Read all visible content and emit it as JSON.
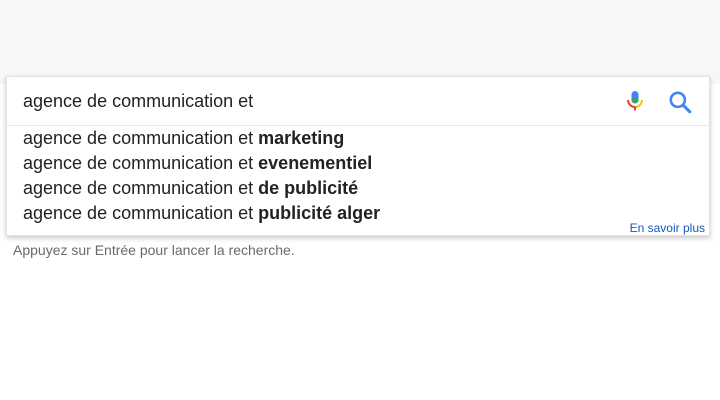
{
  "search": {
    "query": "agence de communication et",
    "suggestions": [
      {
        "prefix": "agence de communication et ",
        "completion": "marketing"
      },
      {
        "prefix": "agence de communication et ",
        "completion": "evenementiel"
      },
      {
        "prefix": "agence de communication et ",
        "completion": "de publicité"
      },
      {
        "prefix": "agence de communication et ",
        "completion": "publicité alger"
      }
    ],
    "learn_more_label": "En savoir plus"
  },
  "hint_text": "Appuyez sur Entrée pour lancer la recherche.",
  "icons": {
    "mic": "microphone-icon",
    "search": "magnifier-icon"
  },
  "colors": {
    "link": "#1a55c4",
    "search_icon": "#4285f4"
  }
}
